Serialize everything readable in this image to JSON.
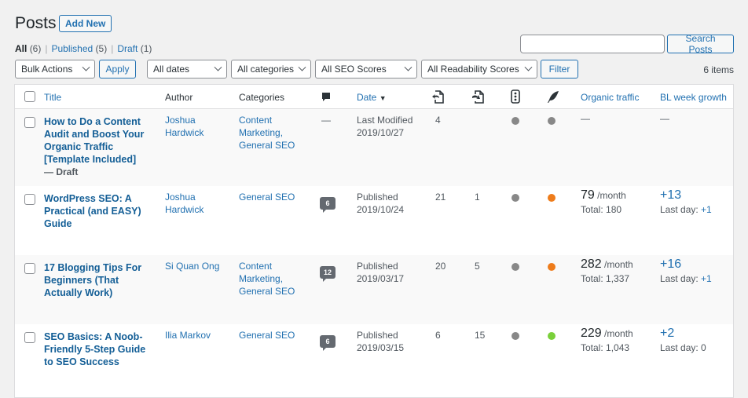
{
  "header": {
    "title": "Posts",
    "add_new_label": "Add New"
  },
  "views": [
    {
      "label": "All",
      "count": "(6)",
      "current": true
    },
    {
      "label": "Published",
      "count": "(5)",
      "current": false
    },
    {
      "label": "Draft",
      "count": "(1)",
      "current": false
    }
  ],
  "view_separator": "|",
  "search": {
    "value": "",
    "placeholder": "",
    "button_label": "Search Posts"
  },
  "filters": {
    "bulk_actions": "Bulk Actions",
    "apply_label": "Apply",
    "dates": "All dates",
    "categories": "All categories",
    "seo_scores": "All SEO Scores",
    "readability_scores": "All Readability Scores",
    "filter_label": "Filter"
  },
  "items_count": "6 items",
  "columns": {
    "title": "Title",
    "author": "Author",
    "categories": "Categories",
    "comments_icon": "comment-bubble-icon",
    "date": "Date",
    "date_sort_indicator": "▼",
    "internal_links_icon": "incoming-links-icon",
    "outgoing_links_icon": "outgoing-links-icon",
    "seo_score_icon": "traffic-light-icon",
    "readability_icon": "feather-icon",
    "organic_traffic": "Organic traffic",
    "bl_week_growth": "BL week growth"
  },
  "rows": [
    {
      "title": "How to Do a Content Audit and Boost Your Organic Traffic [Template Included]",
      "state": "— Draft",
      "author": "Joshua Hardwick",
      "categories": "Content Marketing, General SEO",
      "comments": "—",
      "date_status": "Last Modified",
      "date": "2019/10/27",
      "incoming_links": "4",
      "outgoing_links": "",
      "seo_score_color": "#888888",
      "readability_color": "#888888",
      "traffic_main": "—",
      "traffic_unit": "",
      "traffic_total": "",
      "growth_main": "—",
      "growth_last_day_label": "",
      "growth_last_day_value": ""
    },
    {
      "title": "WordPress SEO: A Practical (and EASY) Guide",
      "state": "",
      "author": "Joshua Hardwick",
      "categories": "General SEO",
      "comments": "6",
      "date_status": "Published",
      "date": "2019/10/24",
      "incoming_links": "21",
      "outgoing_links": "1",
      "seo_score_color": "#888888",
      "readability_color": "#ee7c1b",
      "traffic_main": "79",
      "traffic_unit": "/month",
      "traffic_total": "Total: 180",
      "growth_main": "+13",
      "growth_last_day_label": "Last day:",
      "growth_last_day_value": "+1"
    },
    {
      "title": "17 Blogging Tips For Beginners (That Actually Work)",
      "state": "",
      "author": "Si Quan Ong",
      "categories": "Content Marketing, General SEO",
      "comments": "12",
      "date_status": "Published",
      "date": "2019/03/17",
      "incoming_links": "20",
      "outgoing_links": "5",
      "seo_score_color": "#888888",
      "readability_color": "#ee7c1b",
      "traffic_main": "282",
      "traffic_unit": "/month",
      "traffic_total": "Total: 1,337",
      "growth_main": "+16",
      "growth_last_day_label": "Last day:",
      "growth_last_day_value": "+1"
    },
    {
      "title": "SEO Basics: A Noob-Friendly 5-Step Guide to SEO Success",
      "state": "",
      "author": "Ilia Markov",
      "categories": "General SEO",
      "comments": "6",
      "date_status": "Published",
      "date": "2019/03/15",
      "incoming_links": "6",
      "outgoing_links": "15",
      "seo_score_color": "#888888",
      "readability_color": "#7ad03a",
      "traffic_main": "229",
      "traffic_unit": "/month",
      "traffic_total": "Total: 1,043",
      "growth_main": "+2",
      "growth_last_day_label": "Last day: 0",
      "growth_last_day_value": ""
    }
  ]
}
